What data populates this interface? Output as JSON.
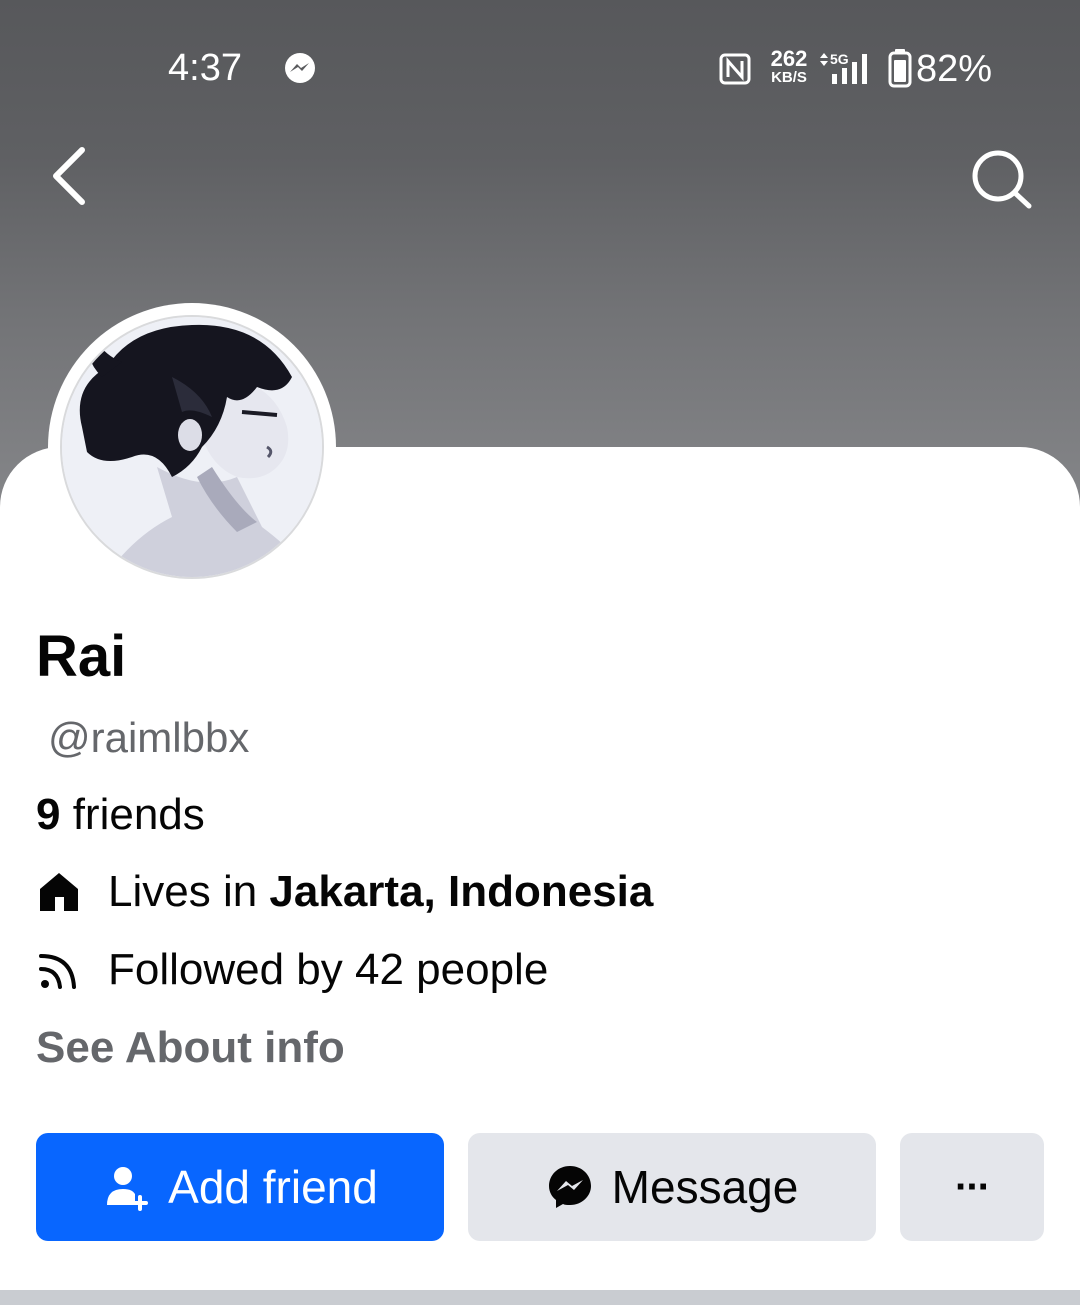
{
  "status_bar": {
    "time": "4:37",
    "speed_value": "262",
    "speed_unit": "KB/S",
    "network": "5G",
    "battery": "82%",
    "icons": [
      "messenger-icon",
      "nfc-icon",
      "signal-icon",
      "battery-icon"
    ]
  },
  "nav": {
    "back_icon": "chevron-left-icon",
    "search_icon": "search-icon"
  },
  "profile": {
    "name": "Rai",
    "username": "@raimlbbx",
    "friends_count": "9",
    "friends_label": " friends",
    "lives_prefix": "Lives in ",
    "lives_location": "Jakarta, Indonesia",
    "followed_text": "Followed by 42 people",
    "see_about": "See About info"
  },
  "actions": {
    "add_friend": "Add friend",
    "message": "Message",
    "more": "···"
  },
  "colors": {
    "primary": "#0866ff",
    "secondary_bg": "#e4e6eb",
    "text_primary": "#050505",
    "text_secondary": "#65676b"
  }
}
